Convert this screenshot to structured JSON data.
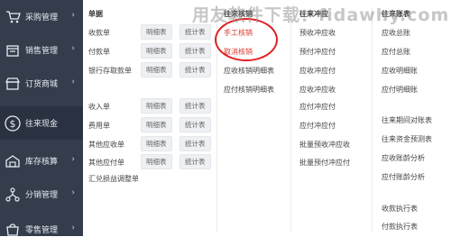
{
  "watermark": "用友软件下载：fidawhy.com",
  "sidebar": {
    "items": [
      {
        "label": "采购管理",
        "icon": "shopping-cart-icon"
      },
      {
        "label": "销售管理",
        "icon": "sales-icon"
      },
      {
        "label": "订货商城",
        "icon": "store-icon"
      },
      {
        "label": "往来现金",
        "icon": "dollar-icon",
        "active": true
      },
      {
        "label": "库存核算",
        "icon": "warehouse-icon"
      },
      {
        "label": "分销管理",
        "icon": "distribution-icon"
      },
      {
        "label": "零售管理",
        "icon": "retail-icon"
      }
    ],
    "arrow": "›"
  },
  "columns": {
    "c1": {
      "title": "单据",
      "rows": [
        {
          "label": "收款单",
          "tags": [
            "明细表",
            "统计表"
          ]
        },
        {
          "label": "付款单",
          "tags": [
            "明细表",
            "统计表"
          ]
        },
        {
          "label": "银行存取款单",
          "tags": [
            "明细表",
            "统计表"
          ]
        },
        {
          "label": "收入单",
          "tags": [
            "明细表",
            "统计表"
          ]
        },
        {
          "label": "费用单",
          "tags": [
            "明细表",
            "统计表"
          ]
        },
        {
          "label": "其他应收单",
          "tags": [
            "明细表",
            "统计表"
          ]
        },
        {
          "label": "其他应付单",
          "tags": [
            "明细表",
            "统计表"
          ]
        },
        {
          "label": "汇兑损益调整单",
          "tags": []
        }
      ]
    },
    "c2": {
      "title": "往来核销",
      "items": [
        "手工核销",
        "取消核销",
        "应收核销明细表",
        "应付核销明细表"
      ]
    },
    "c3": {
      "title": "往来冲应",
      "items": [
        "预收冲应收",
        "预付冲应付",
        "应收冲应付",
        "应收冲应收",
        "应付冲应付",
        "应付冲应付",
        "批量预收冲应收",
        "批量预付冲应付"
      ]
    },
    "c4": {
      "title": "往来账表",
      "items": [
        "应收总账",
        "应付总账",
        "应收明细账",
        "应付明细账",
        "往来期间对账表",
        "往来资金预测表",
        "应收账龄分析",
        "应付账龄分析",
        "收款执行表",
        "付款执行表"
      ]
    }
  },
  "colors": {
    "sidebar": "#343d4c",
    "sidebar_active": "#2a3241",
    "highlight": "#e02020"
  }
}
